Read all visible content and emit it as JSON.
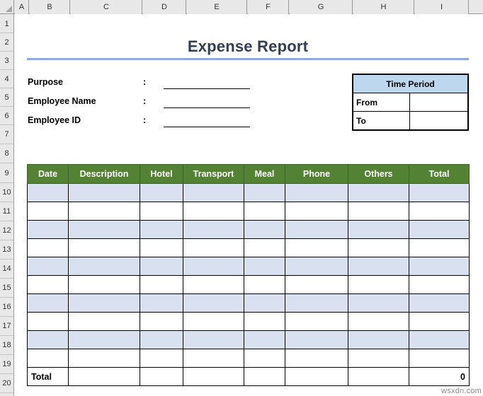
{
  "spreadsheet": {
    "column_headers": [
      "A",
      "B",
      "C",
      "D",
      "E",
      "F",
      "G",
      "H",
      "I"
    ],
    "row_headers": [
      "1",
      "2",
      "3",
      "4",
      "5",
      "6",
      "7",
      "8",
      "9",
      "10",
      "11",
      "12",
      "13",
      "14",
      "15",
      "16",
      "17",
      "18",
      "19",
      "20"
    ],
    "select_all_icon": "select-all-triangle"
  },
  "report": {
    "title": "Expense Report",
    "title_color": "#323e56",
    "rule_color": "#8ea9db"
  },
  "form": {
    "colon": ":",
    "fields": [
      {
        "label": "Purpose",
        "value": ""
      },
      {
        "label": "Employee Name",
        "value": ""
      },
      {
        "label": "Employee ID",
        "value": ""
      }
    ]
  },
  "time_period": {
    "title": "Time Period",
    "title_bg": "#bdd7ee",
    "rows": [
      {
        "label": "From",
        "value": ""
      },
      {
        "label": "To",
        "value": ""
      }
    ]
  },
  "expense_table": {
    "header_bg": "#548235",
    "shaded_row_bg": "#d9e0f0",
    "columns": [
      "Date",
      "Description",
      "Hotel",
      "Transport",
      "Meal",
      "Phone",
      "Others",
      "Total"
    ],
    "rows": [
      [
        "",
        "",
        "",
        "",
        "",
        "",
        "",
        ""
      ],
      [
        "",
        "",
        "",
        "",
        "",
        "",
        "",
        ""
      ],
      [
        "",
        "",
        "",
        "",
        "",
        "",
        "",
        ""
      ],
      [
        "",
        "",
        "",
        "",
        "",
        "",
        "",
        ""
      ],
      [
        "",
        "",
        "",
        "",
        "",
        "",
        "",
        ""
      ],
      [
        "",
        "",
        "",
        "",
        "",
        "",
        "",
        ""
      ],
      [
        "",
        "",
        "",
        "",
        "",
        "",
        "",
        ""
      ],
      [
        "",
        "",
        "",
        "",
        "",
        "",
        "",
        ""
      ],
      [
        "",
        "",
        "",
        "",
        "",
        "",
        "",
        ""
      ],
      [
        "",
        "",
        "",
        "",
        "",
        "",
        "",
        ""
      ]
    ],
    "footer": {
      "label": "Total",
      "blanks": [
        "",
        "",
        "",
        "",
        "",
        ""
      ],
      "value": "0"
    }
  },
  "watermark": {
    "text": "wsxdn.com"
  }
}
